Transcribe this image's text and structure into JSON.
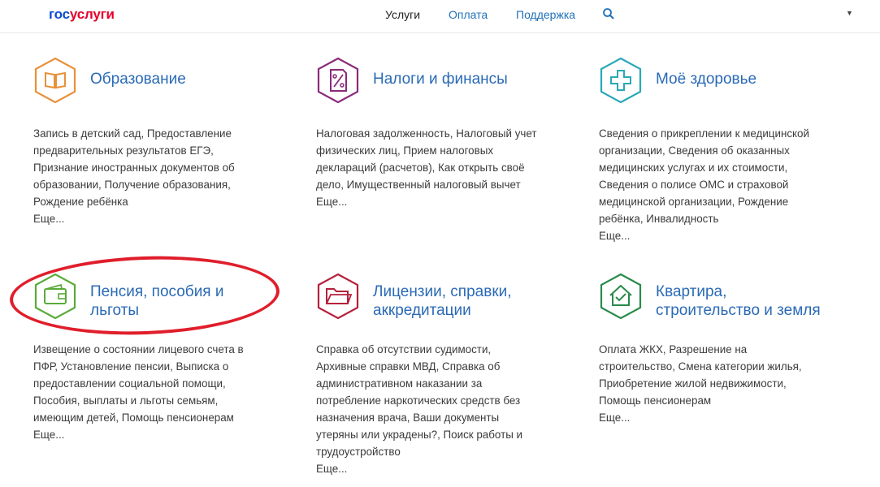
{
  "header": {
    "logo": {
      "part1": "гос",
      "part2": "услуги"
    },
    "nav": [
      {
        "label": "Услуги",
        "active": true
      },
      {
        "label": "Оплата",
        "active": false
      },
      {
        "label": "Поддержка",
        "active": false
      }
    ],
    "search_icon": "search-icon",
    "dropdown_icon": "chevron-down-icon"
  },
  "colors": {
    "link": "#2a6ab5",
    "orange": "#e8913a",
    "purple": "#8a2a7a",
    "teal": "#2aa8b8",
    "green": "#5aaa3a",
    "crimson": "#b5203c",
    "dark_green": "#2a8a4a",
    "highlight": "#e01e2b"
  },
  "categories": [
    {
      "title": "Образование",
      "icon": "book-icon",
      "lines": [
        "Запись в детский сад, Предоставление",
        "предварительных результатов ЕГЭ,",
        "Признание иностранных документов об",
        "образовании, Получение образования,",
        "Рождение ребёнка"
      ],
      "more": "Еще..."
    },
    {
      "title": "Налоги и финансы",
      "icon": "percent-document-icon",
      "lines": [
        "Налоговая задолженность, Налоговый учет",
        "физических лиц, Прием налоговых",
        "деклараций (расчетов), Как открыть своё",
        "дело, Имущественный налоговый вычет"
      ],
      "more": "Еще..."
    },
    {
      "title": "Моё здоровье",
      "icon": "medical-cross-icon",
      "lines": [
        "Сведения о прикреплении к медицинской",
        "организации, Сведения об оказанных",
        "медицинских услугах и их стоимости,",
        "Сведения о полисе ОМС и страховой",
        "медицинской организации, Рождение",
        "ребёнка, Инвалидность"
      ],
      "more": "Еще..."
    },
    {
      "title_lines": [
        "Пенсия, пособия и",
        "льготы"
      ],
      "icon": "wallet-icon",
      "lines": [
        "Извещение о состоянии лицевого счета в",
        "ПФР, Установление пенсии, Выписка о",
        "предоставлении социальной помощи,",
        "Пособия, выплаты и льготы семьям,",
        "имеющим детей, Помощь пенсионерам"
      ],
      "more": "Еще..."
    },
    {
      "title_lines": [
        "Лицензии, справки,",
        "аккредитации"
      ],
      "icon": "folder-icon",
      "lines": [
        "Справка об отсутствии судимости,",
        "Архивные справки МВД, Справка об",
        "административном наказании за",
        "потребление наркотических средств без",
        "назначения врача, Ваши документы",
        "утеряны или украдены?, Поиск работы и",
        "трудоустройство"
      ],
      "more": "Еще..."
    },
    {
      "title_lines": [
        "Квартира,",
        "строительство и земля"
      ],
      "icon": "house-icon",
      "lines": [
        "Оплата ЖКХ, Разрешение на",
        "строительство, Смена категории жилья,",
        "Приобретение жилой недвижимости,",
        "Помощь пенсионерам"
      ],
      "more": "Еще..."
    }
  ]
}
